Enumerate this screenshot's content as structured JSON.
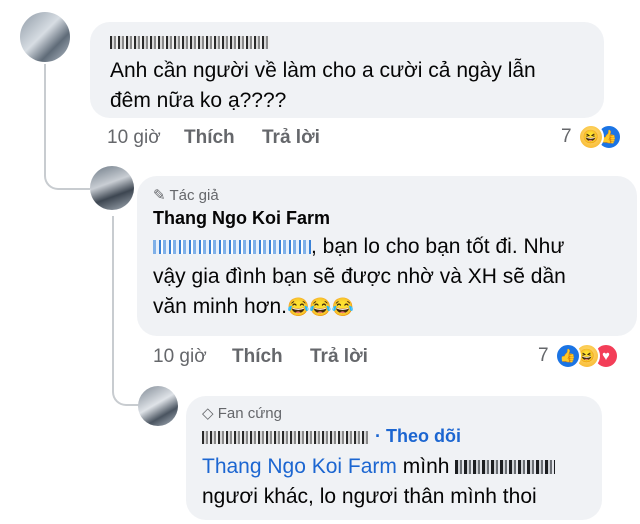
{
  "comment1": {
    "text_line1": "Anh cần người về làm cho a cười cả ngày lẫn",
    "text_line2": "đêm nữa ko ạ????",
    "time": "10 giờ",
    "like": "Thích",
    "reply": "Trả lời",
    "reaction_count": "7"
  },
  "comment2": {
    "badge": "Tác giả",
    "author": "Thang Ngo Koi Farm",
    "text_line1": ", bạn lo cho bạn tốt đi. Như",
    "text_line2": "vậy gia đình bạn sẽ được nhờ và XH sẽ dần",
    "text_line3": "văn minh hơn.",
    "emojis": "😂😂😂",
    "time": "10 giờ",
    "like": "Thích",
    "reply": "Trả lời",
    "reaction_count": "7"
  },
  "comment3": {
    "badge": "Fan cứng",
    "follow": "· Theo dõi",
    "mention": "Thang Ngo Koi Farm",
    "text_line1_suffix": "mình",
    "text_line2": "ngươi khác, lo ngươi thân mình thoi"
  },
  "colors": {
    "bubble": "#f0f2f5",
    "meta": "#65676b",
    "link": "#1c66d1"
  },
  "icons": [
    "like-icon",
    "haha-icon",
    "love-icon",
    "pencil-icon",
    "diamond-icon"
  ]
}
